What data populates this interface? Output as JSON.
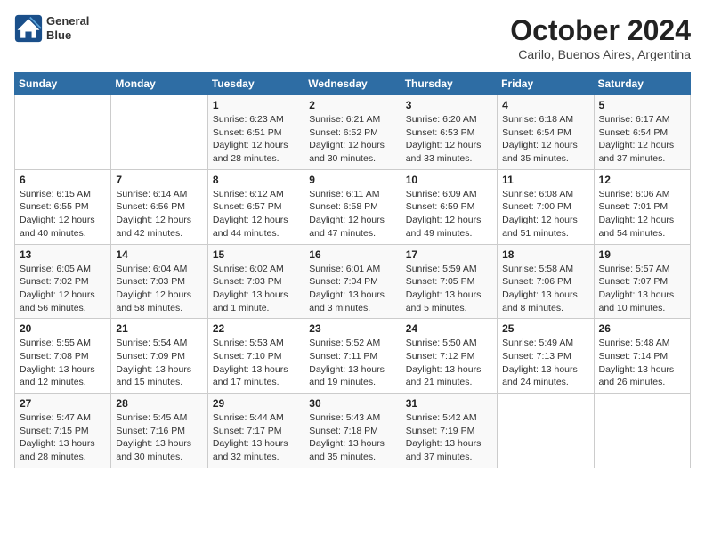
{
  "logo": {
    "line1": "General",
    "line2": "Blue"
  },
  "title": "October 2024",
  "location": "Carilo, Buenos Aires, Argentina",
  "headers": [
    "Sunday",
    "Monday",
    "Tuesday",
    "Wednesday",
    "Thursday",
    "Friday",
    "Saturday"
  ],
  "weeks": [
    [
      {
        "day": "",
        "info": ""
      },
      {
        "day": "",
        "info": ""
      },
      {
        "day": "1",
        "info": "Sunrise: 6:23 AM\nSunset: 6:51 PM\nDaylight: 12 hours and 28 minutes."
      },
      {
        "day": "2",
        "info": "Sunrise: 6:21 AM\nSunset: 6:52 PM\nDaylight: 12 hours and 30 minutes."
      },
      {
        "day": "3",
        "info": "Sunrise: 6:20 AM\nSunset: 6:53 PM\nDaylight: 12 hours and 33 minutes."
      },
      {
        "day": "4",
        "info": "Sunrise: 6:18 AM\nSunset: 6:54 PM\nDaylight: 12 hours and 35 minutes."
      },
      {
        "day": "5",
        "info": "Sunrise: 6:17 AM\nSunset: 6:54 PM\nDaylight: 12 hours and 37 minutes."
      }
    ],
    [
      {
        "day": "6",
        "info": "Sunrise: 6:15 AM\nSunset: 6:55 PM\nDaylight: 12 hours and 40 minutes."
      },
      {
        "day": "7",
        "info": "Sunrise: 6:14 AM\nSunset: 6:56 PM\nDaylight: 12 hours and 42 minutes."
      },
      {
        "day": "8",
        "info": "Sunrise: 6:12 AM\nSunset: 6:57 PM\nDaylight: 12 hours and 44 minutes."
      },
      {
        "day": "9",
        "info": "Sunrise: 6:11 AM\nSunset: 6:58 PM\nDaylight: 12 hours and 47 minutes."
      },
      {
        "day": "10",
        "info": "Sunrise: 6:09 AM\nSunset: 6:59 PM\nDaylight: 12 hours and 49 minutes."
      },
      {
        "day": "11",
        "info": "Sunrise: 6:08 AM\nSunset: 7:00 PM\nDaylight: 12 hours and 51 minutes."
      },
      {
        "day": "12",
        "info": "Sunrise: 6:06 AM\nSunset: 7:01 PM\nDaylight: 12 hours and 54 minutes."
      }
    ],
    [
      {
        "day": "13",
        "info": "Sunrise: 6:05 AM\nSunset: 7:02 PM\nDaylight: 12 hours and 56 minutes."
      },
      {
        "day": "14",
        "info": "Sunrise: 6:04 AM\nSunset: 7:03 PM\nDaylight: 12 hours and 58 minutes."
      },
      {
        "day": "15",
        "info": "Sunrise: 6:02 AM\nSunset: 7:03 PM\nDaylight: 13 hours and 1 minute."
      },
      {
        "day": "16",
        "info": "Sunrise: 6:01 AM\nSunset: 7:04 PM\nDaylight: 13 hours and 3 minutes."
      },
      {
        "day": "17",
        "info": "Sunrise: 5:59 AM\nSunset: 7:05 PM\nDaylight: 13 hours and 5 minutes."
      },
      {
        "day": "18",
        "info": "Sunrise: 5:58 AM\nSunset: 7:06 PM\nDaylight: 13 hours and 8 minutes."
      },
      {
        "day": "19",
        "info": "Sunrise: 5:57 AM\nSunset: 7:07 PM\nDaylight: 13 hours and 10 minutes."
      }
    ],
    [
      {
        "day": "20",
        "info": "Sunrise: 5:55 AM\nSunset: 7:08 PM\nDaylight: 13 hours and 12 minutes."
      },
      {
        "day": "21",
        "info": "Sunrise: 5:54 AM\nSunset: 7:09 PM\nDaylight: 13 hours and 15 minutes."
      },
      {
        "day": "22",
        "info": "Sunrise: 5:53 AM\nSunset: 7:10 PM\nDaylight: 13 hours and 17 minutes."
      },
      {
        "day": "23",
        "info": "Sunrise: 5:52 AM\nSunset: 7:11 PM\nDaylight: 13 hours and 19 minutes."
      },
      {
        "day": "24",
        "info": "Sunrise: 5:50 AM\nSunset: 7:12 PM\nDaylight: 13 hours and 21 minutes."
      },
      {
        "day": "25",
        "info": "Sunrise: 5:49 AM\nSunset: 7:13 PM\nDaylight: 13 hours and 24 minutes."
      },
      {
        "day": "26",
        "info": "Sunrise: 5:48 AM\nSunset: 7:14 PM\nDaylight: 13 hours and 26 minutes."
      }
    ],
    [
      {
        "day": "27",
        "info": "Sunrise: 5:47 AM\nSunset: 7:15 PM\nDaylight: 13 hours and 28 minutes."
      },
      {
        "day": "28",
        "info": "Sunrise: 5:45 AM\nSunset: 7:16 PM\nDaylight: 13 hours and 30 minutes."
      },
      {
        "day": "29",
        "info": "Sunrise: 5:44 AM\nSunset: 7:17 PM\nDaylight: 13 hours and 32 minutes."
      },
      {
        "day": "30",
        "info": "Sunrise: 5:43 AM\nSunset: 7:18 PM\nDaylight: 13 hours and 35 minutes."
      },
      {
        "day": "31",
        "info": "Sunrise: 5:42 AM\nSunset: 7:19 PM\nDaylight: 13 hours and 37 minutes."
      },
      {
        "day": "",
        "info": ""
      },
      {
        "day": "",
        "info": ""
      }
    ]
  ]
}
